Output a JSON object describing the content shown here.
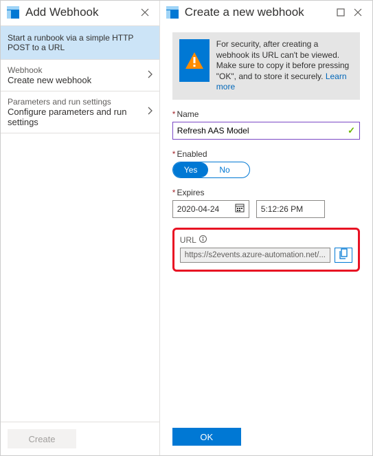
{
  "left": {
    "title": "Add Webhook",
    "banner": "Start a runbook via a simple HTTP POST to a URL",
    "rows": [
      {
        "label": "Webhook",
        "value": "Create new webhook"
      },
      {
        "label": "Parameters and run settings",
        "value": "Configure parameters and run settings"
      }
    ],
    "create_label": "Create"
  },
  "right": {
    "title": "Create a new webhook",
    "callout_text": "For security, after creating a webhook its URL can't be viewed. Make sure to copy it before pressing \"OK\", and to store it securely. ",
    "callout_link": "Learn more",
    "name_label": "Name",
    "name_value": "Refresh AAS Model",
    "enabled_label": "Enabled",
    "toggle_yes": "Yes",
    "toggle_no": "No",
    "expires_label": "Expires",
    "expires_date": "2020-04-24",
    "expires_time": "5:12:26 PM",
    "url_label": "URL",
    "url_value": "https://s2events.azure-automation.net/...",
    "ok_label": "OK"
  }
}
